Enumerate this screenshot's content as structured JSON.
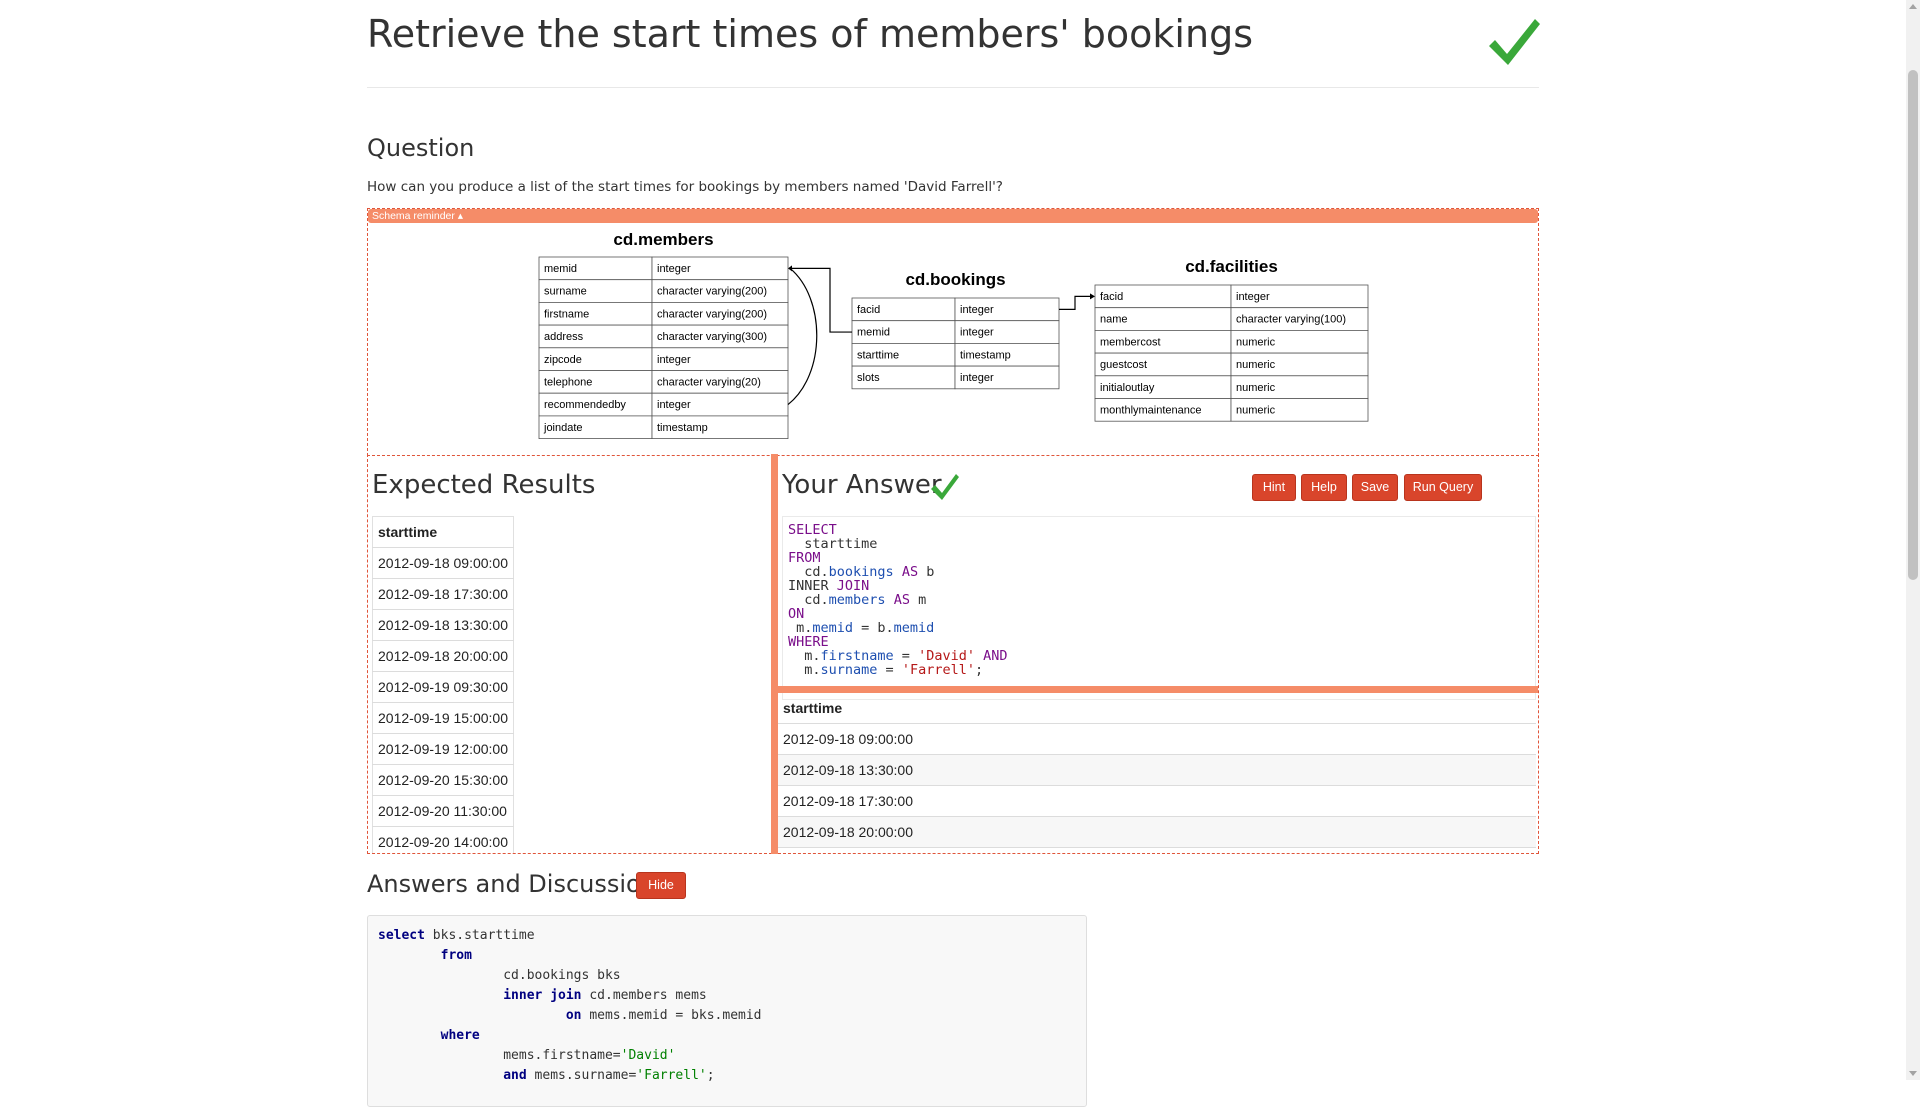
{
  "page": {
    "title": "Retrieve the start times of members' bookings"
  },
  "question": {
    "heading": "Question",
    "text": "How can you produce a list of the start times for bookings by members named 'David Farrell'?"
  },
  "schema": {
    "reminder_label": "Schema reminder ▴",
    "tables": [
      {
        "name": "cd.members",
        "columns": [
          [
            "memid",
            "integer"
          ],
          [
            "surname",
            "character varying(200)"
          ],
          [
            "firstname",
            "character varying(200)"
          ],
          [
            "address",
            "character varying(300)"
          ],
          [
            "zipcode",
            "integer"
          ],
          [
            "telephone",
            "character varying(20)"
          ],
          [
            "recommendedby",
            "integer"
          ],
          [
            "joindate",
            "timestamp"
          ]
        ]
      },
      {
        "name": "cd.bookings",
        "columns": [
          [
            "facid",
            "integer"
          ],
          [
            "memid",
            "integer"
          ],
          [
            "starttime",
            "timestamp"
          ],
          [
            "slots",
            "integer"
          ]
        ]
      },
      {
        "name": "cd.facilities",
        "columns": [
          [
            "facid",
            "integer"
          ],
          [
            "name",
            "character varying(100)"
          ],
          [
            "membercost",
            "numeric"
          ],
          [
            "guestcost",
            "numeric"
          ],
          [
            "initialoutlay",
            "numeric"
          ],
          [
            "monthlymaintenance",
            "numeric"
          ]
        ]
      }
    ]
  },
  "expected": {
    "heading": "Expected Results",
    "column": "starttime",
    "rows": [
      "2012-09-18 09:00:00",
      "2012-09-18 17:30:00",
      "2012-09-18 13:30:00",
      "2012-09-18 20:00:00",
      "2012-09-19 09:30:00",
      "2012-09-19 15:00:00",
      "2012-09-19 12:00:00",
      "2012-09-20 15:30:00",
      "2012-09-20 11:30:00",
      "2012-09-20 14:00:00"
    ]
  },
  "answer": {
    "heading": "Your Answer",
    "buttons": {
      "hint": "Hint",
      "help": "Help",
      "save": "Save",
      "run": "Run Query"
    },
    "code": [
      [
        [
          "kw",
          "SELECT"
        ]
      ],
      [
        [
          "",
          "  starttime"
        ]
      ],
      [
        [
          "kw",
          "FROM"
        ]
      ],
      [
        [
          "",
          "  cd."
        ],
        [
          "fld",
          "bookings"
        ],
        [
          "",
          " "
        ],
        [
          "kw",
          "AS"
        ],
        [
          "",
          " b"
        ]
      ],
      [
        [
          "",
          "INNER "
        ],
        [
          "kw",
          "JOIN"
        ]
      ],
      [
        [
          "",
          "  cd."
        ],
        [
          "fld",
          "members"
        ],
        [
          "",
          " "
        ],
        [
          "kw",
          "AS"
        ],
        [
          "",
          " m"
        ]
      ],
      [
        [
          "kw",
          "ON"
        ]
      ],
      [
        [
          "",
          " m."
        ],
        [
          "fld",
          "memid"
        ],
        [
          "",
          " = b."
        ],
        [
          "fld",
          "memid"
        ]
      ],
      [
        [
          "kw",
          "WHERE"
        ]
      ],
      [
        [
          "",
          "  m."
        ],
        [
          "fld",
          "firstname"
        ],
        [
          "",
          " = "
        ],
        [
          "str",
          "'David'"
        ],
        [
          "",
          " "
        ],
        [
          "kw",
          "AND"
        ]
      ],
      [
        [
          "",
          "  m."
        ],
        [
          "fld",
          "surname"
        ],
        [
          "",
          " = "
        ],
        [
          "str",
          "'Farrell'"
        ],
        [
          "",
          ";"
        ]
      ]
    ],
    "results_column": "starttime",
    "results_rows": [
      "2012-09-18 09:00:00",
      "2012-09-18 13:30:00",
      "2012-09-18 17:30:00",
      "2012-09-18 20:00:00"
    ]
  },
  "discussion": {
    "heading": "Answers and Discussion",
    "hide_label": "Hide",
    "code": [
      [
        [
          "k",
          "select"
        ],
        [
          "",
          " bks.starttime"
        ]
      ],
      [
        [
          "",
          "        "
        ],
        [
          "k",
          "from"
        ]
      ],
      [
        [
          "",
          "                cd.bookings bks"
        ]
      ],
      [
        [
          "",
          "                "
        ],
        [
          "k",
          "inner join"
        ],
        [
          "",
          " cd.members mems"
        ]
      ],
      [
        [
          "",
          "                        "
        ],
        [
          "k",
          "on"
        ],
        [
          "",
          " mems.memid = bks.memid"
        ]
      ],
      [
        [
          "",
          "        "
        ],
        [
          "k",
          "where"
        ]
      ],
      [
        [
          "",
          "                mems.firstname="
        ],
        [
          "s",
          "'David'"
        ]
      ],
      [
        [
          "",
          "                "
        ],
        [
          "k",
          "and"
        ],
        [
          "",
          " mems.surname="
        ],
        [
          "s",
          "'Farrell'"
        ],
        [
          "",
          ";"
        ]
      ]
    ]
  },
  "colors": {
    "accent": "#f58c68",
    "button": "#d9452b",
    "check": "#3aa83a"
  }
}
